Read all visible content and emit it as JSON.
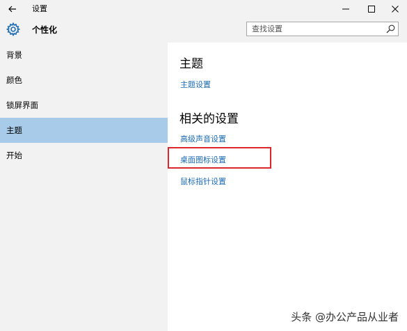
{
  "window": {
    "title": "设置",
    "back_icon": "back-arrow-icon",
    "controls": {
      "minimize": "minimize-icon",
      "maximize": "maximize-icon",
      "close": "close-icon"
    }
  },
  "header": {
    "icon": "gear-icon",
    "title": "个性化",
    "search": {
      "placeholder": "查找设置",
      "value": "",
      "icon": "search-icon"
    }
  },
  "sidebar": {
    "items": [
      {
        "label": "背景",
        "selected": false
      },
      {
        "label": "颜色",
        "selected": false
      },
      {
        "label": "锁屏界面",
        "selected": false
      },
      {
        "label": "主题",
        "selected": true
      },
      {
        "label": "开始",
        "selected": false
      }
    ],
    "selected_color": "#a9cbea"
  },
  "main": {
    "theme_heading": "主题",
    "theme_settings_link": "主题设置",
    "related_heading": "相关的设置",
    "related_links": [
      "高级声音设置",
      "桌面图标设置",
      "鼠标指针设置"
    ],
    "highlighted_link": "桌面图标设置",
    "link_color": "#1c6bb1",
    "highlight_color": "#d9272d"
  },
  "watermark": "头条 @办公产品从业者"
}
